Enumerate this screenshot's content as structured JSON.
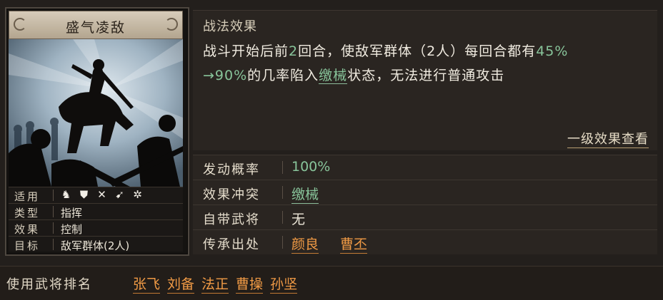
{
  "card": {
    "name": "盛气凌敌",
    "rows": [
      {
        "key": "适用",
        "value": ""
      },
      {
        "key": "类型",
        "value": "指挥"
      },
      {
        "key": "效果",
        "value": "控制"
      },
      {
        "key": "目标",
        "value": "敌军群体(2人)"
      }
    ],
    "applicable_icons": [
      "cavalry-icon",
      "shield-icon",
      "bow-icon",
      "spear-icon",
      "wheel-icon"
    ]
  },
  "effect": {
    "title": "战法效果",
    "parts": [
      "战斗开始后前",
      "2",
      "回合，使敌军群体（2人）每回合都有",
      "45%",
      "→90%",
      "的几率陷入",
      "缴械",
      "状态，无法进行普通攻击"
    ],
    "more_link": "一级效果查看"
  },
  "attributes": {
    "trigger_label": "发动概率",
    "trigger_value": "100%",
    "conflict_label": "效果冲突",
    "conflict_value": "缴械",
    "own_label": "自带武将",
    "own_value": "无",
    "inherit_label": "传承出处",
    "inherit_values": [
      "颜良",
      "曹丕"
    ]
  },
  "usage": {
    "label": "使用武将排名",
    "names": [
      "张飞",
      "刘备",
      "法正",
      "曹操",
      "孙坚"
    ]
  },
  "colors": {
    "highlight_green": "#88c49a",
    "link_orange": "#f09a45",
    "title_parchment": "#c9bca6"
  }
}
